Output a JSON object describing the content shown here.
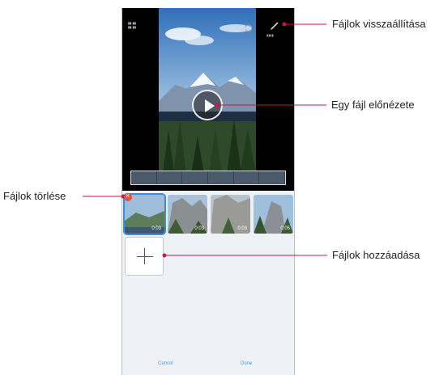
{
  "callouts": {
    "restore": "Fájlok visszaállítása",
    "preview": "Egy fájl előnézete",
    "delete": "Fájlok törlése",
    "add": "Fájlok hozzáadása"
  },
  "colors": {
    "callout_line": "#c8174a",
    "accent": "#4a9be2",
    "delete_badge": "#e4523f"
  },
  "icons": [
    "pencil-icon",
    "undo-icon",
    "play-icon",
    "close-icon",
    "plus-icon"
  ],
  "clips": [
    {
      "duration": "0:03"
    },
    {
      "duration": "0:03"
    },
    {
      "duration": "0:03"
    },
    {
      "duration": "0:05"
    }
  ],
  "bottom": {
    "cancel": "Cancel",
    "done": "Done"
  }
}
